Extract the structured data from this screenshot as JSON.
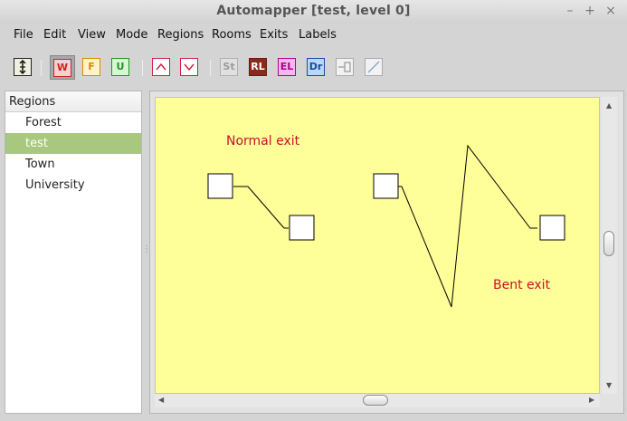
{
  "window": {
    "title": "Automapper [test, level 0]",
    "controls": {
      "minimize": "–",
      "maximize": "+",
      "close": "×"
    }
  },
  "menubar": {
    "items": [
      "File",
      "Edit",
      "View",
      "Mode",
      "Regions",
      "Rooms",
      "Exits",
      "Labels"
    ]
  },
  "toolbar": {
    "buttons": [
      {
        "icon": "up-down-arrow-icon",
        "label": ""
      },
      {
        "icon": "w-mode-icon",
        "label": "W",
        "color": "#cc2222",
        "fill": "#f5d0d0"
      },
      {
        "icon": "f-mode-icon",
        "label": "F",
        "color": "#d88a00",
        "fill": "#fff3c8"
      },
      {
        "icon": "u-mode-icon",
        "label": "U",
        "color": "#1a9a1a",
        "fill": "#d8f5d8"
      },
      {
        "icon": "up-chevron-icon",
        "label": ""
      },
      {
        "icon": "down-chevron-icon",
        "label": ""
      },
      {
        "icon": "st-icon",
        "label": "St",
        "color": "#9a9a9a"
      },
      {
        "icon": "rl-icon",
        "label": "RL",
        "color": "#ffffff",
        "fill": "#8b2a1a"
      },
      {
        "icon": "el-icon",
        "label": "EL",
        "color": "#b0008a",
        "fill": "#f5b8ec"
      },
      {
        "icon": "dr-icon",
        "label": "Dr",
        "color": "#1a4aa0",
        "fill": "#b8d8f5"
      },
      {
        "icon": "door-icon",
        "label": ""
      },
      {
        "icon": "diagonal-exit-icon",
        "label": ""
      }
    ]
  },
  "regions": {
    "header": "Regions",
    "items": [
      "Forest",
      "test",
      "Town",
      "University"
    ],
    "selected": "test"
  },
  "map": {
    "background": "#ffff99",
    "labels": {
      "normal_exit": "Normal exit",
      "bent_exit": "Bent exit"
    },
    "label_color": "#c8102e"
  }
}
